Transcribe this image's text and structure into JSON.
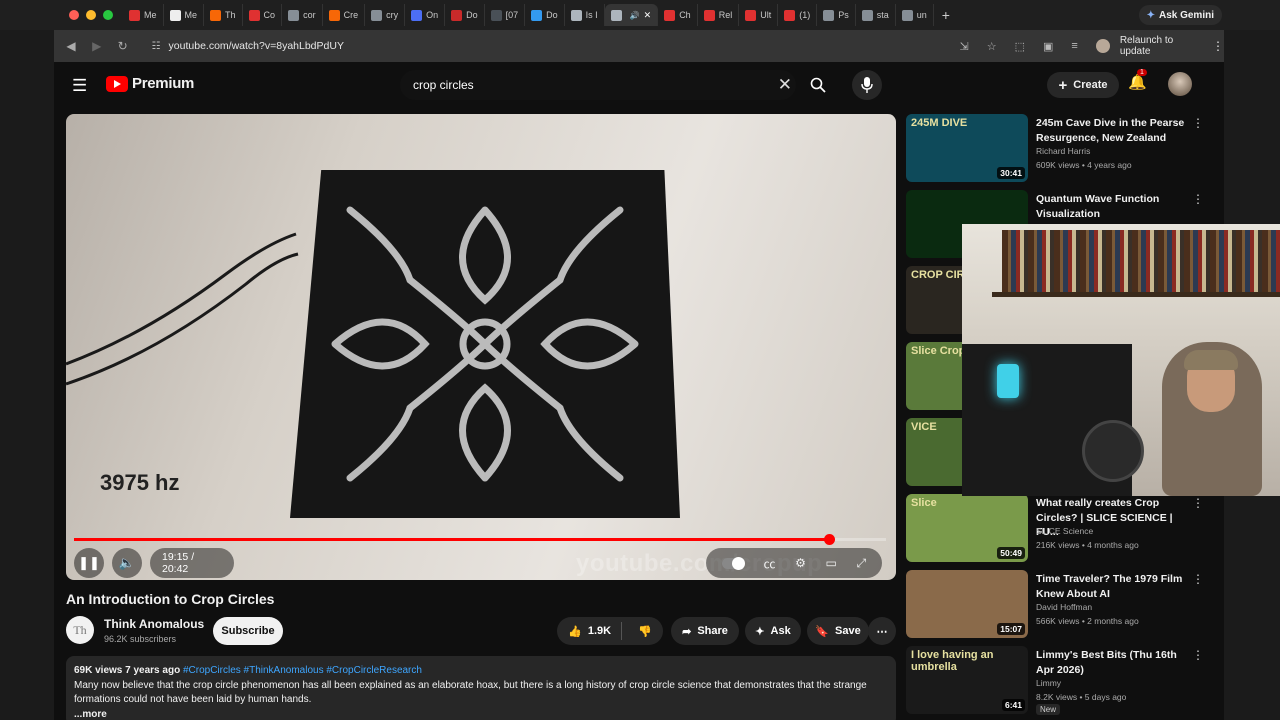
{
  "browser": {
    "tabs": [
      {
        "label": "Me",
        "color": "#e03131"
      },
      {
        "label": "Me",
        "color": "#eeeeee"
      },
      {
        "label": "Th",
        "color": "#f76707"
      },
      {
        "label": "Co",
        "color": "#e03131"
      },
      {
        "label": "cor",
        "color": "#868e96"
      },
      {
        "label": "Cre",
        "color": "#f76707"
      },
      {
        "label": "cry",
        "color": "#868e96"
      },
      {
        "label": "On",
        "color": "#4c6ef5"
      },
      {
        "label": "Do",
        "color": "#c92a2a"
      },
      {
        "label": "[07",
        "color": "#495057"
      },
      {
        "label": "Do",
        "color": "#339af0"
      },
      {
        "label": "Is I",
        "color": "#adb5bd"
      },
      {
        "label": "",
        "color": "#adb5bd"
      },
      {
        "label": "Ch",
        "color": "#e03131"
      },
      {
        "label": "Rel",
        "color": "#e03131"
      },
      {
        "label": "Ult",
        "color": "#e03131"
      },
      {
        "label": "(1)",
        "color": "#e03131"
      },
      {
        "label": "Ps",
        "color": "#868e96"
      },
      {
        "label": "sta",
        "color": "#868e96"
      },
      {
        "label": "un",
        "color": "#868e96"
      }
    ],
    "gemini_label": "Ask Gemini",
    "url": "youtube.com/watch?v=8yahLbdPdUY",
    "relaunch_label": "Relaunch to update"
  },
  "youtube": {
    "logo_text": "Premium",
    "search_value": "crop circles",
    "create_label": "Create",
    "notification_count": "1",
    "video": {
      "overlay_text": "3975 hz",
      "time": "19:15 / 20:42",
      "progress": 0.93,
      "watermark": "youtube.com/cropup"
    },
    "title": "An Introduction to Crop Circles",
    "channel": {
      "avatar_text": "Th",
      "name": "Think Anomalous",
      "subscribers": "96.2K subscribers",
      "subscribe_label": "Subscribe"
    },
    "actions": {
      "likes": "1.9K",
      "share": "Share",
      "ask": "Ask",
      "save": "Save"
    },
    "description": {
      "meta": "69K views  7 years ago ",
      "tags": "#CropCircles #ThinkAnomalous #CropCircleResearch",
      "text": "Many now believe that the crop circle phenomenon has all been explained as an elaborate hoax, but there is a long history of crop circle science that demonstrates that the strange formations could not have been laid by human hands.",
      "more": "...more"
    },
    "recommendations": [
      {
        "title": "245m Cave Dive in the Pearse Resurgence, New Zealand",
        "channel": "Richard Harris",
        "meta": "609K views • 4 years ago",
        "duration": "30:41",
        "thumb_text": "245M DIVE",
        "thumb_color": "#0e4a5a"
      },
      {
        "title": "Quantum Wave Function Visualization",
        "channel": "",
        "meta": "",
        "duration": "",
        "thumb_text": "",
        "thumb_color": "#0a2a10"
      },
      {
        "title": "",
        "channel": "",
        "meta": "",
        "duration": "",
        "thumb_text": "CROP CIR CONSPIRA",
        "thumb_color": "#2a2620"
      },
      {
        "title": "",
        "channel": "",
        "meta": "",
        "duration": "",
        "thumb_text": "Slice Crop",
        "thumb_color": "#5a7a3a"
      },
      {
        "title": "",
        "channel": "",
        "meta": "",
        "duration": "",
        "thumb_text": "VICE",
        "thumb_color": "#4a6a30"
      },
      {
        "title": "What really creates Crop Circles? | SLICE SCIENCE | FU...",
        "channel": "SLICE Science",
        "meta": "216K views • 4 months ago",
        "duration": "50:49",
        "thumb_text": "Slice",
        "thumb_color": "#7a9a4a"
      },
      {
        "title": "Time Traveler? The 1979 Film Knew About AI",
        "channel": "David Hoffman",
        "meta": "566K views • 2 months ago",
        "duration": "15:07",
        "thumb_text": "",
        "thumb_color": "#8a6a4a"
      },
      {
        "title": "Limmy's Best Bits (Thu 16th Apr 2026)",
        "channel": "Limmy",
        "meta": "8.2K views • 5 days ago",
        "duration": "6:41",
        "thumb_text": "I love having an umbrella",
        "thumb_color": "#1a1a1a",
        "badge": "New"
      }
    ]
  }
}
